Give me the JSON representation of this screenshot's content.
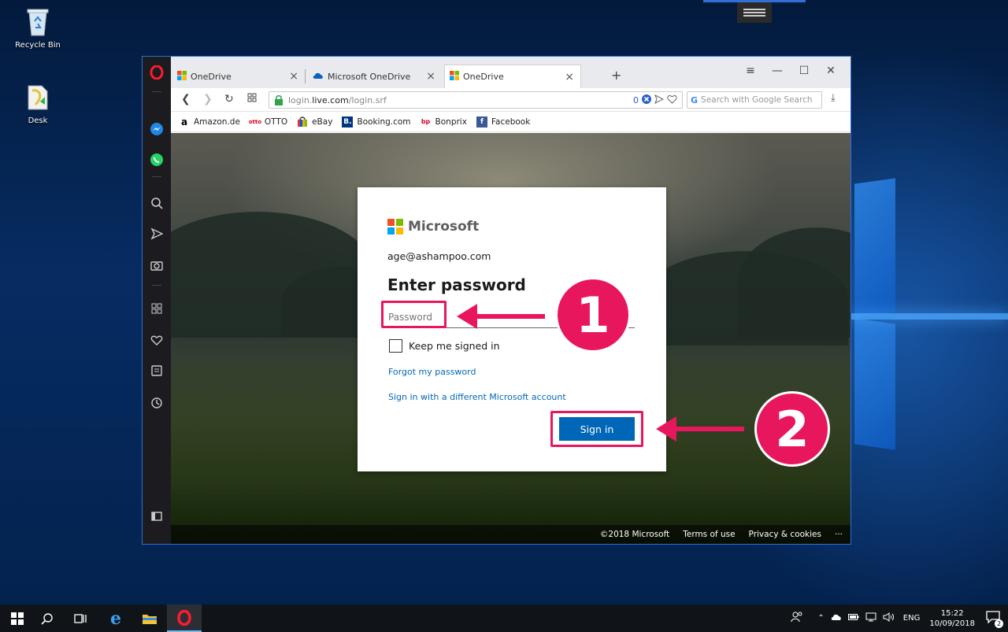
{
  "desktop": {
    "icons": [
      {
        "label": "Recycle Bin",
        "icon": "recycle-bin-icon"
      },
      {
        "label": "Desk",
        "icon": "folder-icon"
      }
    ]
  },
  "browser": {
    "tabs": [
      {
        "title": "OneDrive",
        "icon": "microsoft-logo-icon",
        "close": "×"
      },
      {
        "title": "Microsoft OneDrive",
        "icon": "onedrive-cloud-icon",
        "close": "×"
      },
      {
        "title": "OneDrive",
        "icon": "microsoft-logo-icon",
        "close": "×",
        "active": true
      }
    ],
    "new_tab": "+",
    "window_controls": {
      "menu": "≡",
      "minimize": "—",
      "maximize": "☐",
      "close": "✕"
    },
    "address": {
      "prefix": "login.",
      "host": "live.com",
      "path": "/login.srf",
      "badge_count": "0"
    },
    "search_placeholder": "Search with Google Search",
    "bookmarks": [
      {
        "label": "Amazon.de",
        "icon": "amazon-icon"
      },
      {
        "label": "OTTO",
        "icon": "otto-icon"
      },
      {
        "label": "eBay",
        "icon": "ebay-icon"
      },
      {
        "label": "Booking.com",
        "icon": "booking-icon"
      },
      {
        "label": "Bonprix",
        "icon": "bonprix-icon"
      },
      {
        "label": "Facebook",
        "icon": "facebook-icon"
      }
    ],
    "sidebar": [
      "messenger-icon",
      "whatsapp-icon",
      "search-icon",
      "send-icon",
      "camera-icon",
      "speed-dial-icon",
      "heart-icon",
      "news-icon",
      "history-icon",
      "sidebar-toggle-icon"
    ]
  },
  "login": {
    "brand": "Microsoft",
    "email": "age@ashampoo.com",
    "heading": "Enter password",
    "password_placeholder": "Password",
    "keep_signed_in": "Keep me signed in",
    "forgot_password": "Forgot my password",
    "different_account": "Sign in with a different Microsoft account",
    "sign_in": "Sign in"
  },
  "footer": {
    "copyright": "©2018 Microsoft",
    "terms": "Terms of use",
    "privacy": "Privacy & cookies",
    "more": "···"
  },
  "annotations": {
    "step1": "1",
    "step2": "2",
    "color": "#e8175d"
  },
  "taskbar": {
    "language": "ENG",
    "time": "15:22",
    "date": "10/09/2018",
    "notification_count": "2"
  },
  "colors": {
    "accent": "#0067b8",
    "highlight": "#e8175d"
  }
}
